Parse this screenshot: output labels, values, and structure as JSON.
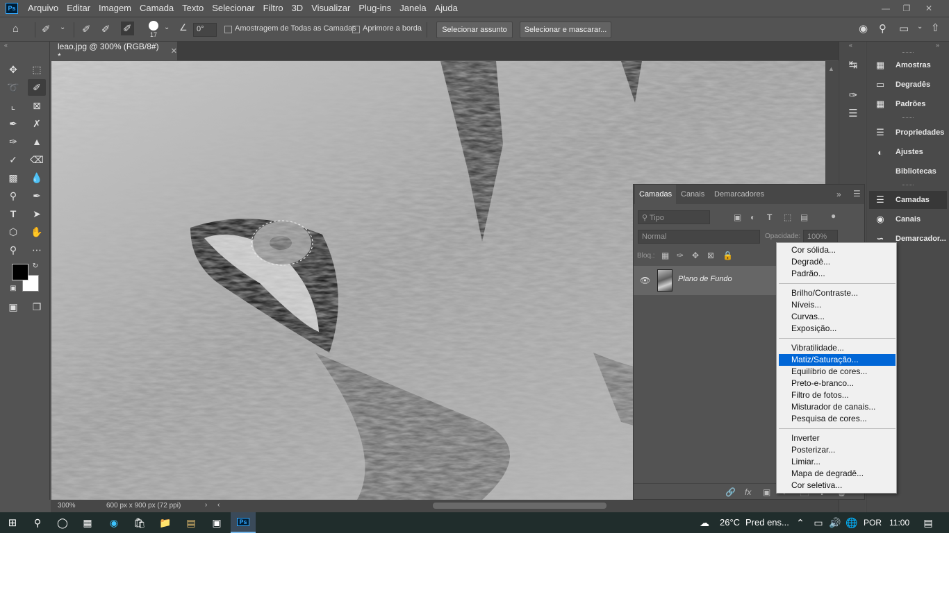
{
  "app": {
    "logo": "Ps",
    "menu": [
      "Arquivo",
      "Editar",
      "Imagem",
      "Camada",
      "Texto",
      "Selecionar",
      "Filtro",
      "3D",
      "Visualizar",
      "Plug-ins",
      "Janela",
      "Ajuda"
    ]
  },
  "options": {
    "brush_size": "17",
    "angle": "0°",
    "sample_all_layers": "Amostragem de Todas as Camadas",
    "enhance_edge": "Aprimore a borda",
    "select_subject": "Selecionar assunto",
    "select_and_mask": "Selecionar e mascarar..."
  },
  "document": {
    "tab_title": "leao.jpg @ 300% (RGB/8#) *",
    "zoom": "300%",
    "dimensions": "600 px x 900 px (72 ppi)"
  },
  "right_panels": {
    "group1": [
      "Amostras",
      "Degradês",
      "Padrões"
    ],
    "group2": [
      "Propriedades",
      "Ajustes",
      "Bibliotecas"
    ],
    "group3": [
      "Camadas",
      "Canais",
      "Demarcador..."
    ]
  },
  "layers_panel": {
    "tabs": [
      "Camadas",
      "Canais",
      "Demarcadores"
    ],
    "filter_placeholder": "Tipo",
    "blend_mode": "Normal",
    "opacity_label": "Opacidade:",
    "opacity_value": "100%",
    "lock_label": "Bloq.:",
    "layer_name": "Plano de Fundo"
  },
  "adjustment_menu": {
    "group1": [
      "Cor sólida...",
      "Degradê...",
      "Padrão..."
    ],
    "group2": [
      "Brilho/Contraste...",
      "Níveis...",
      "Curvas...",
      "Exposição..."
    ],
    "group3": [
      "Vibratilidade...",
      "Matiz/Saturação...",
      "Equilíbrio de cores...",
      "Preto-e-branco...",
      "Filtro de fotos...",
      "Misturador de canais...",
      "Pesquisa de cores..."
    ],
    "group4": [
      "Inverter",
      "Posterizar...",
      "Limiar...",
      "Mapa de degradê...",
      "Cor seletiva..."
    ],
    "highlighted": "Matiz/Saturação..."
  },
  "taskbar": {
    "temperature": "26°C",
    "weather": "Pred ens...",
    "language": "POR",
    "time": "11:00"
  }
}
